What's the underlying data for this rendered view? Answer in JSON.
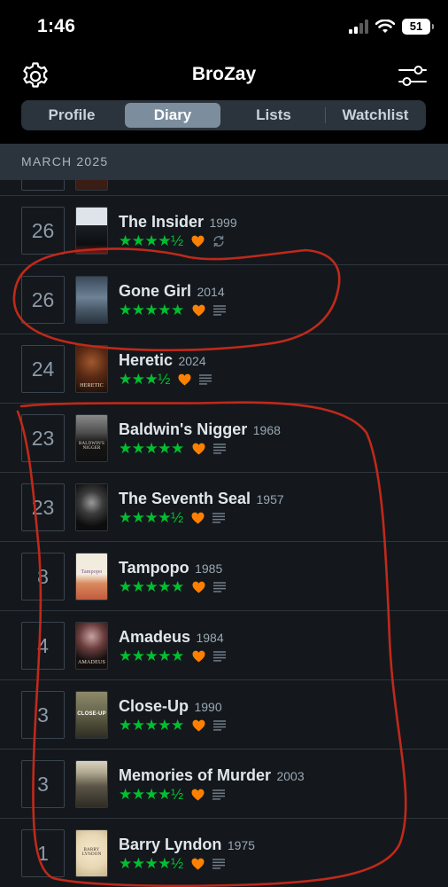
{
  "status": {
    "time": "1:46",
    "battery": "51"
  },
  "header": {
    "title": "BroZay",
    "settings_icon": "gear-icon",
    "filter_icon": "sliders-icon",
    "tabs": [
      {
        "label": "Profile",
        "active": false
      },
      {
        "label": "Diary",
        "active": true
      },
      {
        "label": "Lists",
        "active": false
      },
      {
        "label": "Watchlist",
        "active": false
      }
    ]
  },
  "section": {
    "title": "MARCH 2025"
  },
  "colors": {
    "stars": "#00c030",
    "heart": "#ff8000",
    "annotation": "#c0291a"
  },
  "entries": [
    {
      "day": "26",
      "title": "The Insider",
      "year": "1999",
      "stars": "★★★★½",
      "liked": true,
      "rewatch": true,
      "review": false
    },
    {
      "day": "26",
      "title": "Gone Girl",
      "year": "2014",
      "stars": "★★★★★",
      "liked": true,
      "rewatch": false,
      "review": true
    },
    {
      "day": "24",
      "title": "Heretic",
      "year": "2024",
      "stars": "★★★½",
      "liked": true,
      "rewatch": false,
      "review": true,
      "poster_text": "HERETIC"
    },
    {
      "day": "23",
      "title": "Baldwin's Nigger",
      "year": "1968",
      "stars": "★★★★★",
      "liked": true,
      "rewatch": false,
      "review": true,
      "poster_text": "BALDWIN'S NIGGER"
    },
    {
      "day": "23",
      "title": "The Seventh Seal",
      "year": "1957",
      "stars": "★★★★½",
      "liked": true,
      "rewatch": false,
      "review": true
    },
    {
      "day": "8",
      "title": "Tampopo",
      "year": "1985",
      "stars": "★★★★★",
      "liked": true,
      "rewatch": false,
      "review": true,
      "poster_text": "Tampopo"
    },
    {
      "day": "4",
      "title": "Amadeus",
      "year": "1984",
      "stars": "★★★★★",
      "liked": true,
      "rewatch": false,
      "review": true,
      "poster_text": "AMADEUS"
    },
    {
      "day": "3",
      "title": "Close-Up",
      "year": "1990",
      "stars": "★★★★★",
      "liked": true,
      "rewatch": false,
      "review": true,
      "poster_text": "CLOSE-UP"
    },
    {
      "day": "3",
      "title": "Memories of Murder",
      "year": "2003",
      "stars": "★★★★½",
      "liked": true,
      "rewatch": false,
      "review": true
    },
    {
      "day": "1",
      "title": "Barry Lyndon",
      "year": "1975",
      "stars": "★★★★½",
      "liked": true,
      "rewatch": false,
      "review": true,
      "poster_text": "BARRY LYNDON"
    }
  ]
}
